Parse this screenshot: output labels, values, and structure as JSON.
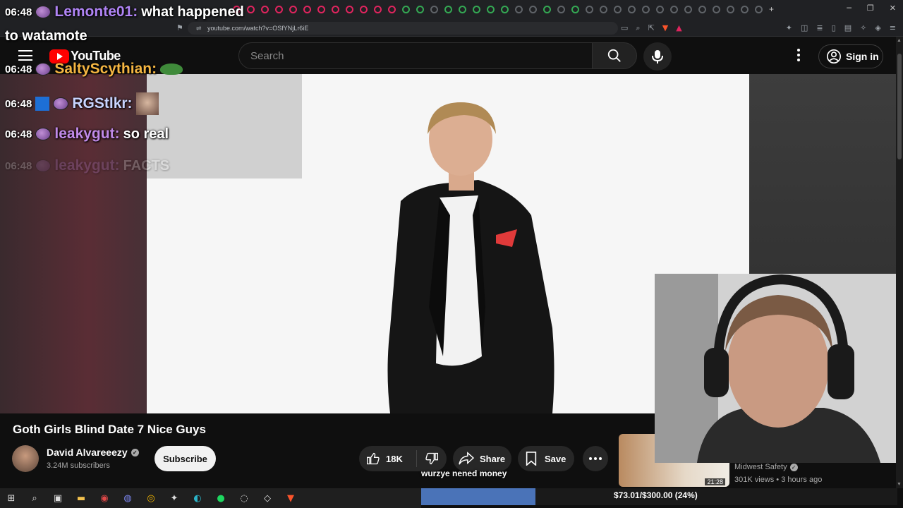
{
  "browser": {
    "url": "youtube.com/watch?v=OSfYNjLr6iE"
  },
  "masthead": {
    "logo_text": "YouTube",
    "search_placeholder": "Search",
    "signin_label": "Sign in"
  },
  "chat": {
    "messages": [
      {
        "time": "06:48",
        "user": "Lemonte01:",
        "user_color": "#b084f5",
        "text": "what happened",
        "continuation": "to watamote"
      },
      {
        "time": "06:48",
        "user": "SaltyScythian:",
        "user_color": "#f5b642",
        "text": ""
      },
      {
        "time": "06:48",
        "user": "RGStlkr:",
        "user_color": "#c8d4ff",
        "text": ""
      },
      {
        "time": "06:48",
        "user": "leakygut:",
        "user_color": "#c08ae8",
        "text": "so real"
      },
      {
        "time": "06:48",
        "user": "leakygut:",
        "user_color": "#c08ae8",
        "text": "FACTS"
      }
    ]
  },
  "video": {
    "title": "Goth Girls Blind Date 7 Nice Guys",
    "channel_name": "David Alvareeezy",
    "subscribers": "3.24M subscribers",
    "subscribe_label": "Subscribe",
    "likes": "18K",
    "share_label": "Share",
    "save_label": "Save"
  },
  "recommendation": {
    "channel": "Midwest Safety",
    "meta": "301K views • 3 hours ago",
    "duration": "21:28"
  },
  "stream_overlay": {
    "goal_message": "wurzye nened money",
    "goal_text": "$73.01/$300.00 (24%)",
    "goal_fraction": 0.24,
    "goal_color": "#4a73b8"
  },
  "colors": {
    "accent": "#ff0000",
    "background": "#0f0f0f"
  }
}
